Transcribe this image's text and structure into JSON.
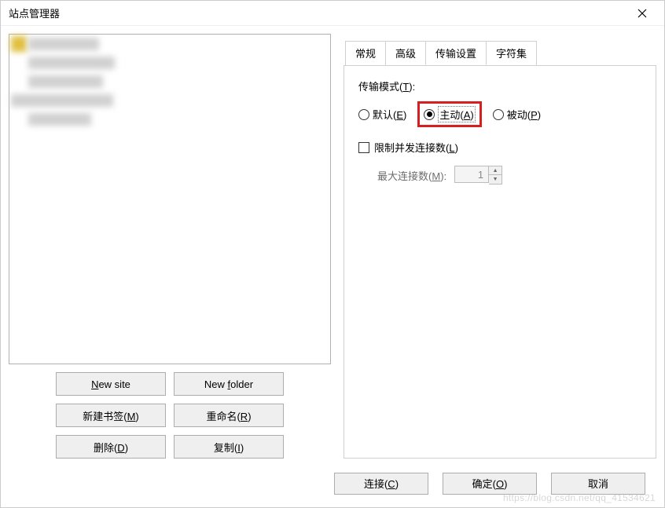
{
  "titlebar": {
    "title": "站点管理器"
  },
  "left": {
    "buttons": {
      "new_site": "New site",
      "new_folder": "New folder",
      "new_bookmark": "新建书签(M)",
      "rename": "重命名(R)",
      "delete": "删除(D)",
      "copy": "复制(I)"
    }
  },
  "tabs": {
    "general": "常规",
    "advanced": "高级",
    "transfer": "传输设置",
    "charset": "字符集"
  },
  "panel": {
    "transfer_mode_label": "传输模式(T):",
    "radio_default": "默认(E)",
    "radio_active": "主动(A)",
    "radio_passive": "被动(P)",
    "limit_conn_label": "限制并发连接数(L)",
    "max_conn_label": "最大连接数(M):",
    "max_conn_value": "1"
  },
  "footer": {
    "connect": "连接(C)",
    "ok": "确定(O)",
    "cancel": "取消"
  },
  "watermark": "https://blog.csdn.net/qq_41534621"
}
